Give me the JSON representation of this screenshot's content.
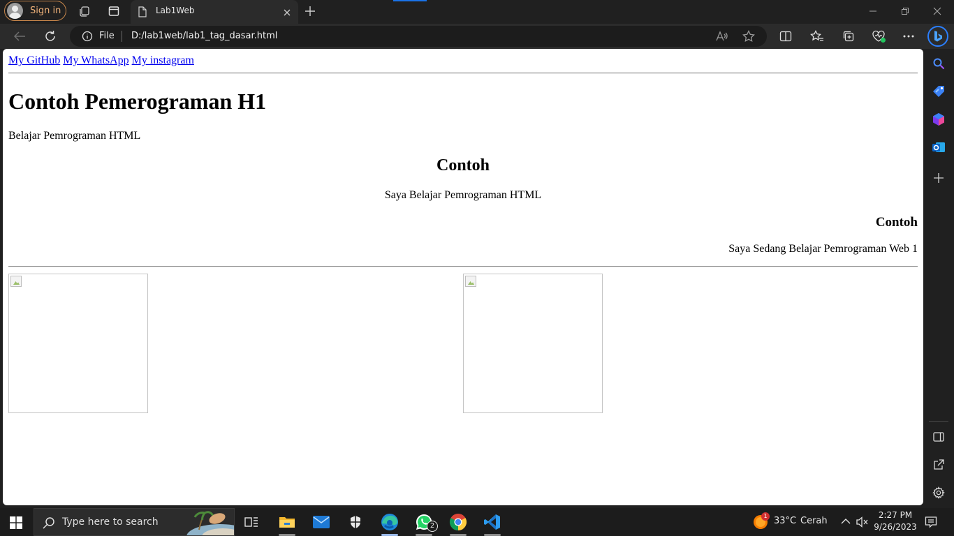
{
  "browser": {
    "signin_label": "Sign in",
    "tab_title": "Lab1Web",
    "address": {
      "scheme_label": "File",
      "url": "D:/lab1web/lab1_tag_dasar.html"
    }
  },
  "page": {
    "nav_links": [
      "My GitHub",
      "My WhatsApp",
      "My instagram"
    ],
    "h1": "Contoh Pemerograman H1",
    "p1": "Belajar Pemrograman HTML",
    "center_heading": "Contoh",
    "center_paragraph": "Saya Belajar Pemrograman HTML",
    "right_heading": "Contoh",
    "right_paragraph": "Saya Sedang Belajar Pemrograman Web 1"
  },
  "taskbar": {
    "search_placeholder": "Type here to search",
    "whatsapp_badge": "2",
    "weather": {
      "temp": "33°C",
      "condition": "Cerah",
      "badge": "1"
    },
    "clock": {
      "time": "2:27 PM",
      "date": "9/26/2023"
    }
  },
  "colors": {
    "accent": "#1a73e8",
    "link": "#0000ee",
    "signin_border": "#c7864b"
  }
}
